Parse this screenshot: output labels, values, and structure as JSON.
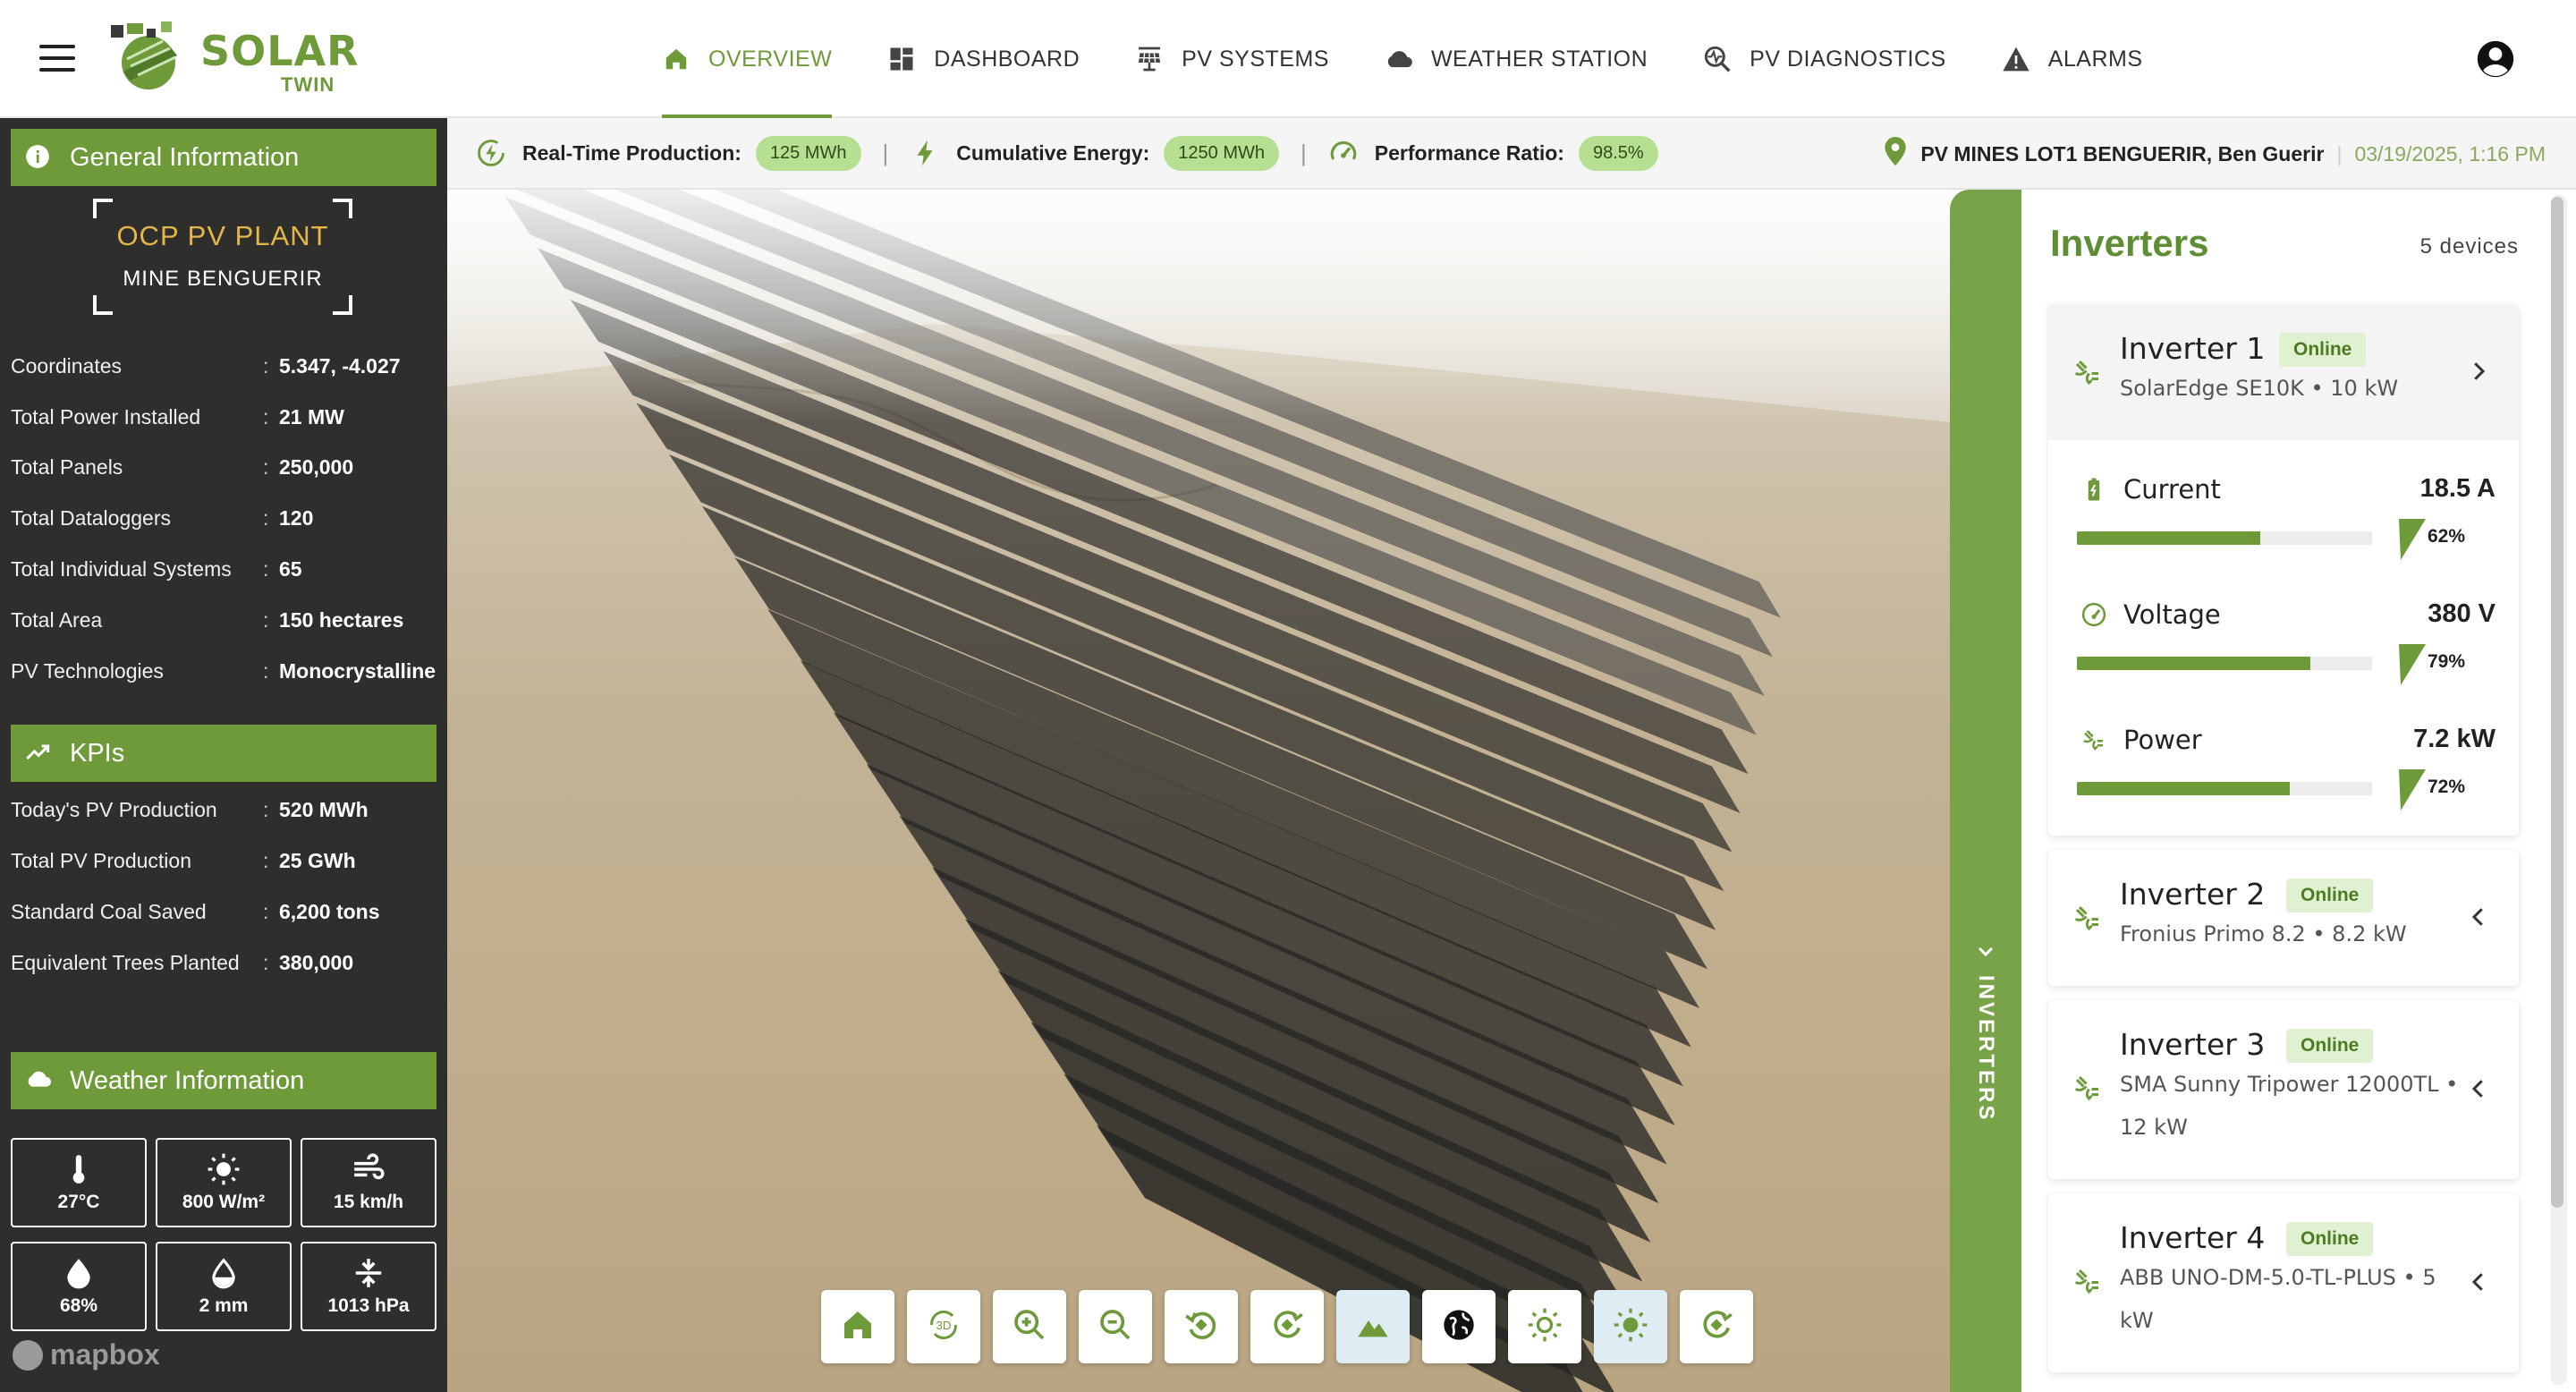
{
  "brand": {
    "name_main": "SOLAR",
    "name_sub": "TWIN",
    "accent": "#6e9a3a"
  },
  "nav": {
    "items": [
      {
        "label": "OVERVIEW",
        "icon": "home-icon",
        "active": true
      },
      {
        "label": "DASHBOARD",
        "icon": "dashboard-icon",
        "active": false
      },
      {
        "label": "PV SYSTEMS",
        "icon": "solar-panel-icon",
        "active": false
      },
      {
        "label": "WEATHER STATION",
        "icon": "cloud-icon",
        "active": false
      },
      {
        "label": "PV DIAGNOSTICS",
        "icon": "diagnostics-icon",
        "active": false
      },
      {
        "label": "ALARMS",
        "icon": "warning-icon",
        "active": false
      }
    ]
  },
  "status": {
    "realtime_label": "Real-Time Production:",
    "realtime_value": "125 MWh",
    "cumulative_label": "Cumulative Energy:",
    "cumulative_value": "1250 MWh",
    "ratio_label": "Performance Ratio:",
    "ratio_value": "98.5%",
    "location": "PV MINES LOT1 BENGUERIR, Ben Guerir",
    "datetime": "03/19/2025, 1:16 PM"
  },
  "general": {
    "header": "General Information",
    "plant_name": "OCP PV PLANT",
    "plant_sub": "MINE BENGUERIR",
    "rows": [
      {
        "label": "Coordinates",
        "value": "5.347, -4.027"
      },
      {
        "label": "Total Power Installed",
        "value": "21 MW"
      },
      {
        "label": "Total Panels",
        "value": "250,000"
      },
      {
        "label": "Total Dataloggers",
        "value": "120"
      },
      {
        "label": "Total Individual Systems",
        "value": "65"
      },
      {
        "label": "Total Area",
        "value": "150 hectares"
      },
      {
        "label": "PV Technologies",
        "value": "Monocrystalline"
      }
    ]
  },
  "kpis": {
    "header": "KPIs",
    "rows": [
      {
        "label": "Today's PV Production",
        "value": "520 MWh"
      },
      {
        "label": "Total PV Production",
        "value": "25 GWh"
      },
      {
        "label": "Standard Coal Saved",
        "value": "6,200 tons"
      },
      {
        "label": "Equivalent Trees Planted",
        "value": "380,000"
      }
    ]
  },
  "weather": {
    "header": "Weather Information",
    "tiles": [
      {
        "icon": "thermometer-icon",
        "value": "27°C"
      },
      {
        "icon": "sun-icon",
        "value": "800 W/m²"
      },
      {
        "icon": "wind-icon",
        "value": "15 km/h"
      },
      {
        "icon": "humidity-icon",
        "value": "68%"
      },
      {
        "icon": "rain-icon",
        "value": "2 mm"
      },
      {
        "icon": "pressure-icon",
        "value": "1013 hPa"
      }
    ]
  },
  "map": {
    "attribution": "mapbox"
  },
  "inverters": {
    "tab_label": "INVERTERS",
    "title": "Inverters",
    "count": "5 devices",
    "list": [
      {
        "name": "Inverter 1",
        "status": "Online",
        "model": "SolarEdge SE10K • 10 kW",
        "metrics": [
          {
            "label": "Current",
            "value": "18.5 A",
            "percent": 62,
            "percent_label": "62%"
          },
          {
            "label": "Voltage",
            "value": "380 V",
            "percent": 79,
            "percent_label": "79%"
          },
          {
            "label": "Power",
            "value": "7.2 kW",
            "percent": 72,
            "percent_label": "72%"
          }
        ]
      },
      {
        "name": "Inverter 2",
        "status": "Online",
        "model": "Fronius Primo 8.2 • 8.2 kW"
      },
      {
        "name": "Inverter 3",
        "status": "Online",
        "model": "SMA Sunny Tripower 12000TL • 12 kW"
      },
      {
        "name": "Inverter 4",
        "status": "Online",
        "model": "ABB UNO-DM-5.0-TL-PLUS • 5 kW"
      }
    ]
  }
}
